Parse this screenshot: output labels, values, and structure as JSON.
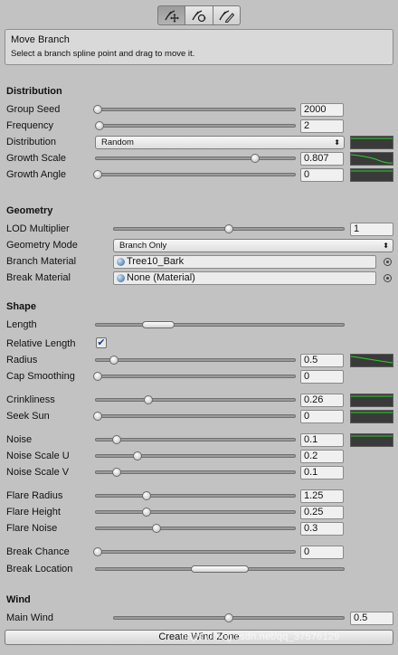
{
  "toolbar": {
    "tools": [
      {
        "name": "move-branch",
        "icon": "move-branch-icon",
        "active": true
      },
      {
        "name": "rotate-branch",
        "icon": "rotate-branch-icon",
        "active": false
      },
      {
        "name": "free-hand",
        "icon": "free-hand-icon",
        "active": false
      }
    ]
  },
  "help": {
    "title": "Move Branch",
    "description": "Select a branch spline point and drag to move it."
  },
  "distribution": {
    "header": "Distribution",
    "group_seed": {
      "label": "Group Seed",
      "value": "2000"
    },
    "frequency": {
      "label": "Frequency",
      "value": "2"
    },
    "distribution": {
      "label": "Distribution",
      "value": "Random"
    },
    "growth_scale": {
      "label": "Growth Scale",
      "value": "0.807"
    },
    "growth_angle": {
      "label": "Growth Angle",
      "value": "0"
    }
  },
  "geometry": {
    "header": "Geometry",
    "lod_multiplier": {
      "label": "LOD Multiplier",
      "value": "1"
    },
    "geometry_mode": {
      "label": "Geometry Mode",
      "value": "Branch Only"
    },
    "branch_material": {
      "label": "Branch Material",
      "value": "Tree10_Bark"
    },
    "break_material": {
      "label": "Break Material",
      "value": "None (Material)"
    }
  },
  "shape": {
    "header": "Shape",
    "length": {
      "label": "Length"
    },
    "relative_length": {
      "label": "Relative Length",
      "checked": true,
      "check_glyph": "✔"
    },
    "radius": {
      "label": "Radius",
      "value": "0.5"
    },
    "cap_smoothing": {
      "label": "Cap Smoothing",
      "value": "0"
    },
    "crinkliness": {
      "label": "Crinkliness",
      "value": "0.26"
    },
    "seek_sun": {
      "label": "Seek Sun",
      "value": "0"
    },
    "noise": {
      "label": "Noise",
      "value": "0.1"
    },
    "noise_scale_u": {
      "label": "Noise Scale U",
      "value": "0.2"
    },
    "noise_scale_v": {
      "label": "Noise Scale V",
      "value": "0.1"
    },
    "flare_radius": {
      "label": "Flare Radius",
      "value": "1.25"
    },
    "flare_height": {
      "label": "Flare Height",
      "value": "0.25"
    },
    "flare_noise": {
      "label": "Flare Noise",
      "value": "0.3"
    },
    "break_chance": {
      "label": "Break Chance",
      "value": "0"
    },
    "break_location": {
      "label": "Break Location"
    }
  },
  "wind": {
    "header": "Wind",
    "main_wind": {
      "label": "Main Wind",
      "value": "0.5"
    },
    "create_wind_zone": "Create Wind Zone"
  },
  "watermark": "https://blog.csdn.net/qq_37576129",
  "colors": {
    "curve_bg": "#3a3a3a",
    "curve_line": "#2bd12b",
    "panel_bg": "#c2c2c2"
  }
}
